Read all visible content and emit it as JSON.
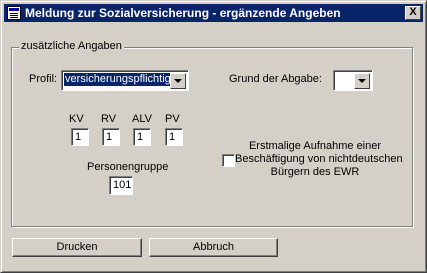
{
  "window": {
    "title": "Meldung zur Sozialversicherung - ergänzende Angeben",
    "close_symbol": "X",
    "icon": "form-icon"
  },
  "group": {
    "legend": "zusätzliche Angaben"
  },
  "profil": {
    "label": "Profil:",
    "value": "versicherungspflichtig"
  },
  "grund": {
    "label": "Grund der Abgabe:",
    "value": ""
  },
  "beitraege": [
    {
      "label": "KV",
      "value": "1"
    },
    {
      "label": "RV",
      "value": "1"
    },
    {
      "label": "ALV",
      "value": "1"
    },
    {
      "label": "PV",
      "value": "1"
    }
  ],
  "personengruppe": {
    "label": "Personengruppe",
    "value": "101"
  },
  "ewr": {
    "line1": "Erstmalige Aufnahme einer",
    "line2": "Beschäftigung von nichtdeutschen",
    "line3": "Bürgern des EWR",
    "checked": false
  },
  "buttons": {
    "print": "Drucken",
    "cancel": "Abbruch"
  }
}
